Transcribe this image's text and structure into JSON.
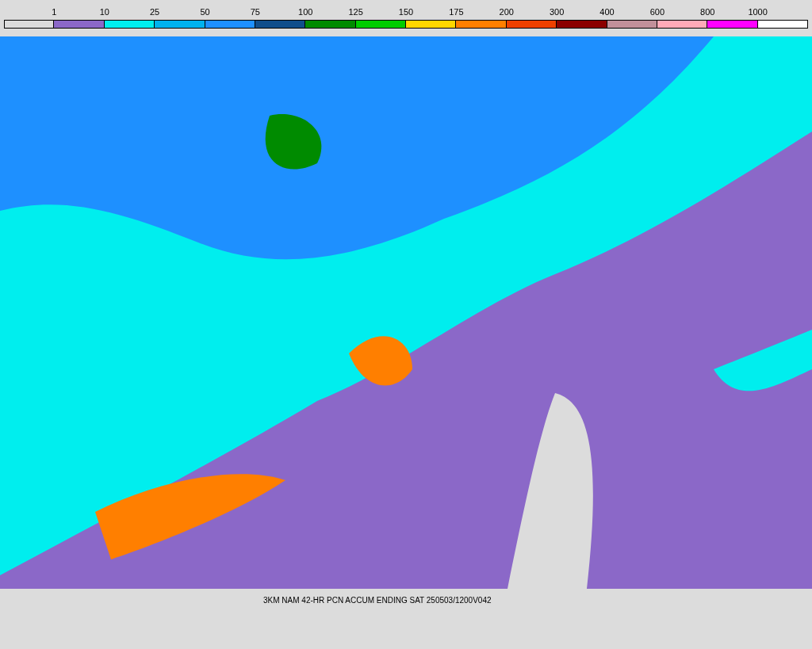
{
  "legend": {
    "labels": [
      "1",
      "10",
      "25",
      "50",
      "75",
      "100",
      "125",
      "150",
      "175",
      "200",
      "300",
      "400",
      "600",
      "800",
      "1000"
    ],
    "swatches": [
      {
        "color": "#dcdcdc"
      },
      {
        "color": "#8b68c8"
      },
      {
        "color": "#00eeee"
      },
      {
        "color": "#00b2ee"
      },
      {
        "color": "#1e90ff"
      },
      {
        "color": "#104e8b"
      },
      {
        "color": "#008b00"
      },
      {
        "color": "#00cd00"
      },
      {
        "color": "#ffd700"
      },
      {
        "color": "#ff7f00"
      },
      {
        "color": "#ee4000"
      },
      {
        "color": "#8b0000"
      },
      {
        "color": "#c1909a"
      },
      {
        "color": "#ffaab8"
      },
      {
        "color": "#ff00ff"
      },
      {
        "color": "#ffffff"
      }
    ]
  },
  "caption": "3KM NAM 42-HR PCN ACCUM ENDING SAT 250503/1200V042"
}
